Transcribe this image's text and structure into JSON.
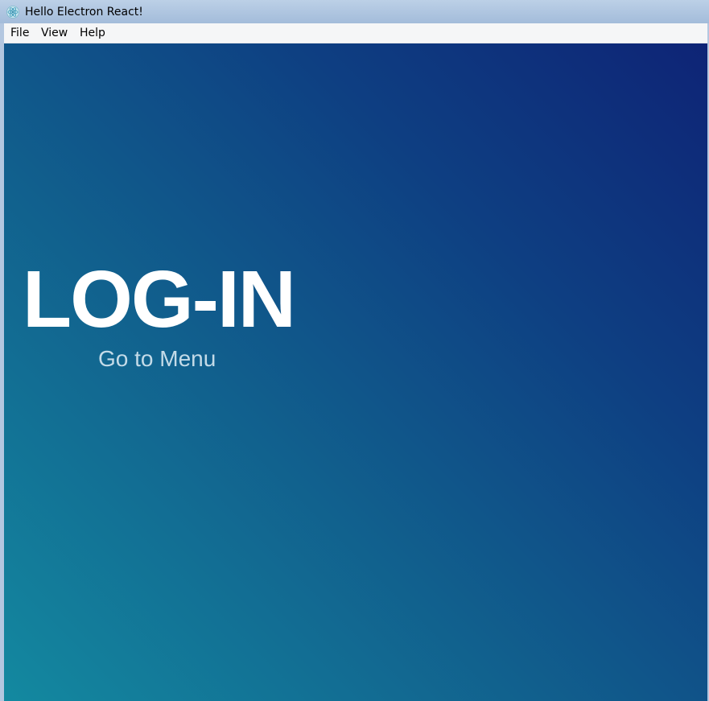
{
  "window": {
    "title": "Hello Electron React!",
    "icon": "electron-atom-icon"
  },
  "menubar": {
    "items": [
      {
        "label": "File"
      },
      {
        "label": "View"
      },
      {
        "label": "Help"
      }
    ]
  },
  "main": {
    "heading": "LOG-IN",
    "link_label": "Go to Menu"
  },
  "colors": {
    "heading_text": "#ffffff",
    "link_text": "#c4dbe8",
    "gradient_top_right": "#0e2476",
    "gradient_bottom_left": "#1389a0",
    "menubar_bg": "#f5f6f7",
    "titlebar_bg": "#a3bcda"
  }
}
